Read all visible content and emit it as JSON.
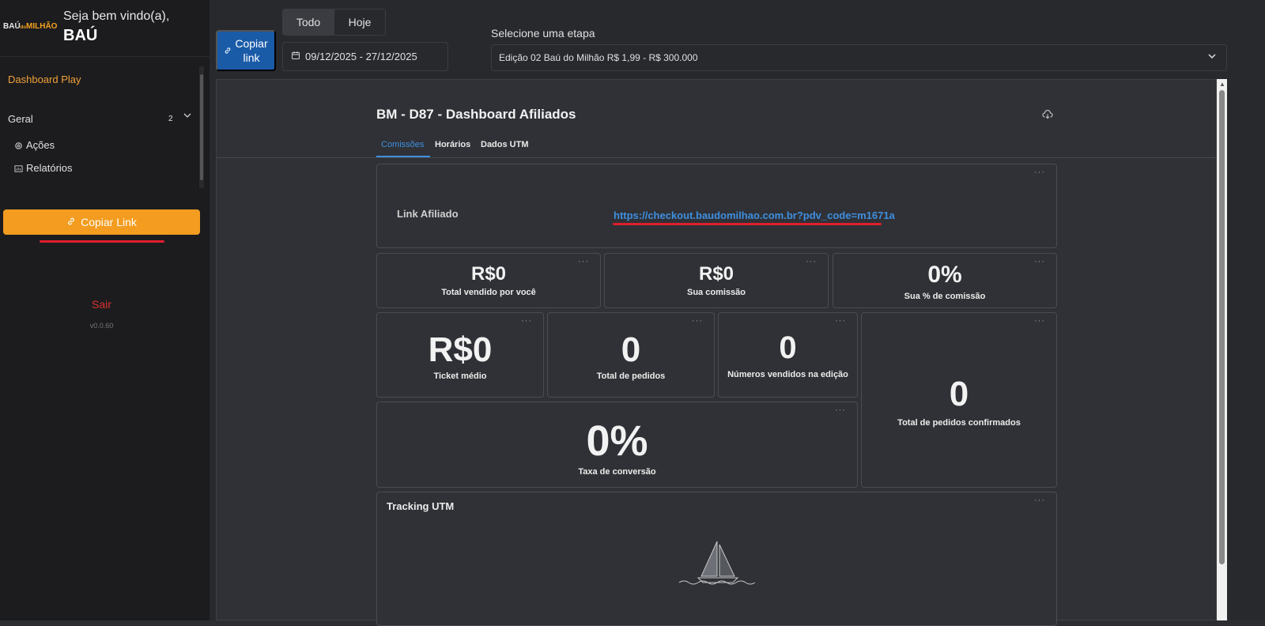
{
  "sidebar": {
    "logo_left": "BAÚ",
    "logo_mid": "do",
    "logo_right": "MILHÃO",
    "welcome": "Seja bem vindo(a),",
    "username": "BAÚ",
    "dashboard_link": "Dashboard Play",
    "group_label": "Geral",
    "group_count": "2",
    "items": [
      {
        "label": "Ações",
        "icon": "gear-icon"
      },
      {
        "label": "Relatórios",
        "icon": "report-icon"
      }
    ],
    "copy_link": "Copiar Link",
    "logout": "Sair",
    "version": "v0.0.60"
  },
  "toolbar": {
    "copy_line1": "Copiar",
    "copy_line2": "link",
    "seg_all": "Todo",
    "seg_today": "Hoje",
    "date_range": "09/12/2025 - 27/12/2025",
    "stage_label": "Selecione uma etapa",
    "stage_value": "Edição 02 Baú do Milhão R$ 1,99 - R$ 300.000"
  },
  "dashboard": {
    "title": "BM - D87 - Dashboard Afiliados",
    "tabs": [
      "Comissões",
      "Horários",
      "Dados UTM"
    ],
    "link_label": "Link Afiliado",
    "link_url": "https://checkout.baudomilhao.com.br?pdv_code=m1671a",
    "cards": {
      "total_sold": {
        "value": "R$0",
        "label": "Total vendido por você"
      },
      "commission": {
        "value": "R$0",
        "label": "Sua comissão"
      },
      "commission_pct": {
        "value": "0%",
        "label": "Sua % de comissão"
      },
      "ticket": {
        "value": "R$0",
        "label": "Ticket médio"
      },
      "orders": {
        "value": "0",
        "label": "Total de pedidos"
      },
      "numbers_sold": {
        "value": "0",
        "label": "Números vendidos na edição"
      },
      "confirmed": {
        "value": "0",
        "label": "Total de pedidos confirmados"
      },
      "conversion": {
        "value": "0%",
        "label": "Taxa de conversão"
      }
    },
    "tracking_title": "Tracking UTM",
    "menu_dots": "···"
  },
  "colors": {
    "accent_orange": "#f39c1f",
    "primary_blue": "#1a5ba8",
    "link_blue": "#3f8fe0",
    "logout_red": "#d9332d"
  }
}
